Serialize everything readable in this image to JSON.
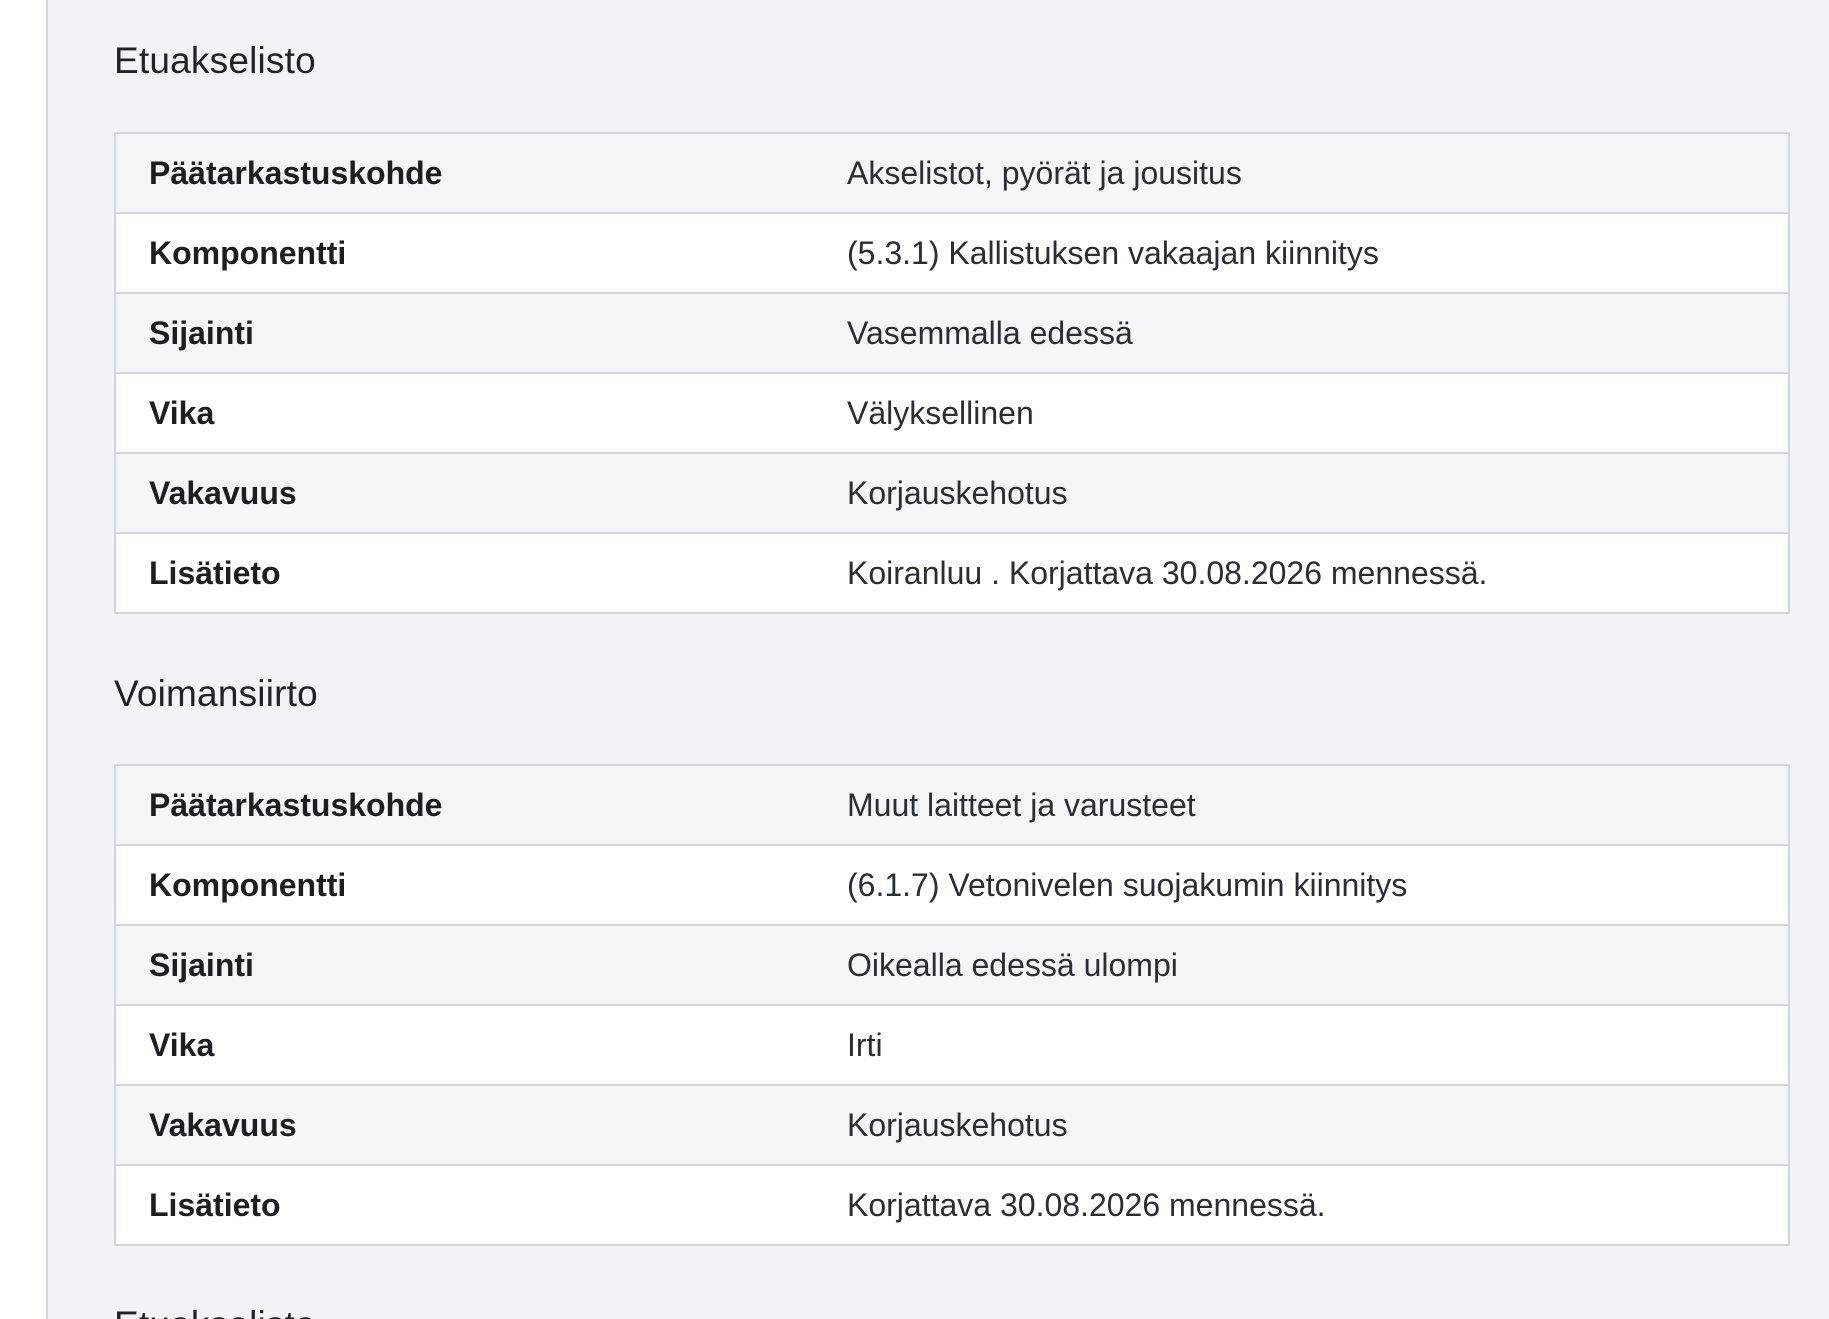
{
  "sections": [
    {
      "title": "Etuakselisto",
      "rows": [
        {
          "label": "Päätarkastuskohde",
          "value": "Akselistot, pyörät ja jousitus"
        },
        {
          "label": "Komponentti",
          "value": "(5.3.1) Kallistuksen vakaajan kiinnitys"
        },
        {
          "label": "Sijainti",
          "value": "Vasemmalla edessä"
        },
        {
          "label": "Vika",
          "value": "Välyksellinen"
        },
        {
          "label": "Vakavuus",
          "value": "Korjauskehotus"
        },
        {
          "label": "Lisätieto",
          "value": "Koiranluu . Korjattava 30.08.2026 mennessä."
        }
      ]
    },
    {
      "title": "Voimansiirto",
      "rows": [
        {
          "label": "Päätarkastuskohde",
          "value": "Muut laitteet ja varusteet"
        },
        {
          "label": "Komponentti",
          "value": "(6.1.7) Vetonivelen suojakumin kiinnitys"
        },
        {
          "label": "Sijainti",
          "value": "Oikealla edessä ulompi"
        },
        {
          "label": "Vika",
          "value": "Irti"
        },
        {
          "label": "Vakavuus",
          "value": "Korjauskehotus"
        },
        {
          "label": "Lisätieto",
          "value": "Korjattava 30.08.2026 mennessä."
        }
      ]
    },
    {
      "title": "Etuakselisto"
    }
  ]
}
